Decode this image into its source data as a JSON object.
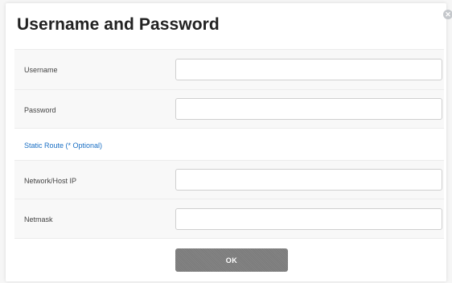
{
  "dialog": {
    "title": "Username and Password",
    "close_icon": "close-icon"
  },
  "form": {
    "username": {
      "label": "Username",
      "value": "",
      "placeholder": ""
    },
    "password": {
      "label": "Password",
      "value": "",
      "placeholder": ""
    },
    "static_route_label": "Static Route (* Optional)",
    "network_host_ip": {
      "label": "Network/Host IP",
      "value": "",
      "placeholder": ""
    },
    "netmask": {
      "label": "Netmask",
      "value": "",
      "placeholder": ""
    }
  },
  "actions": {
    "ok_label": "OK"
  },
  "colors": {
    "link_blue": "#1a6fc4",
    "button_gray": "#7a7a7a"
  }
}
